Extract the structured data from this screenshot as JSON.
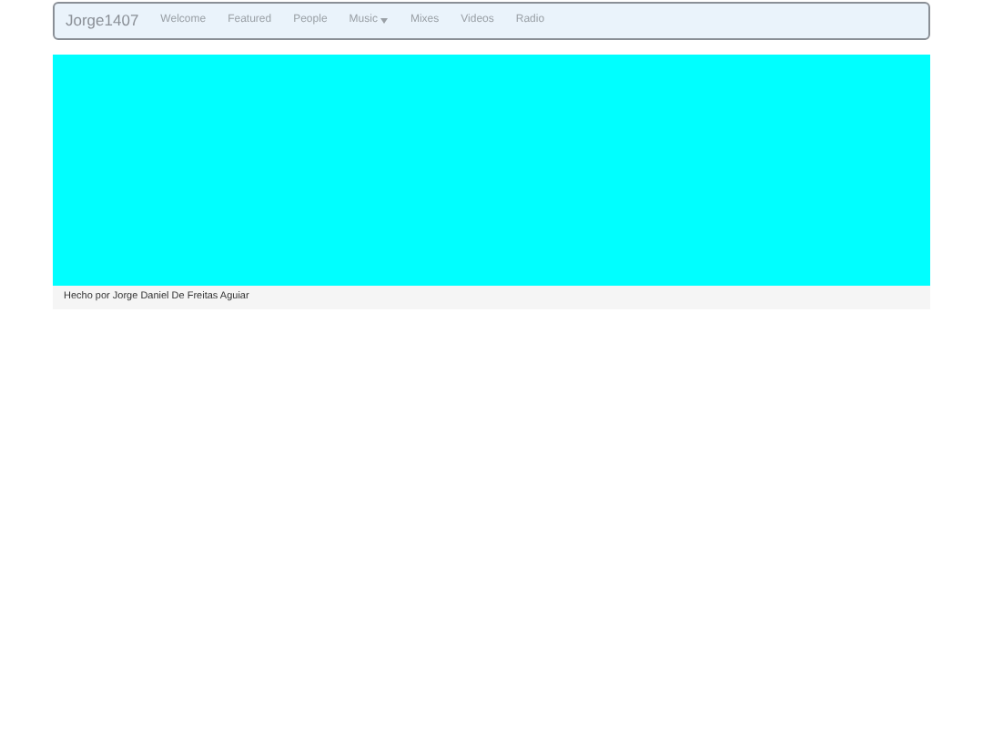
{
  "navbar": {
    "brand": "Jorge1407",
    "items": [
      {
        "label": "Welcome",
        "kind": "link"
      },
      {
        "label": "Featured",
        "kind": "link"
      },
      {
        "label": "People",
        "kind": "link"
      },
      {
        "label": "Music",
        "kind": "dropdown"
      },
      {
        "label": "Mixes",
        "kind": "link"
      },
      {
        "label": "Videos",
        "kind": "link"
      },
      {
        "label": "Radio",
        "kind": "link"
      }
    ]
  },
  "footer": {
    "text": "Hecho por Jorge Daniel De Freitas Aguiar"
  }
}
